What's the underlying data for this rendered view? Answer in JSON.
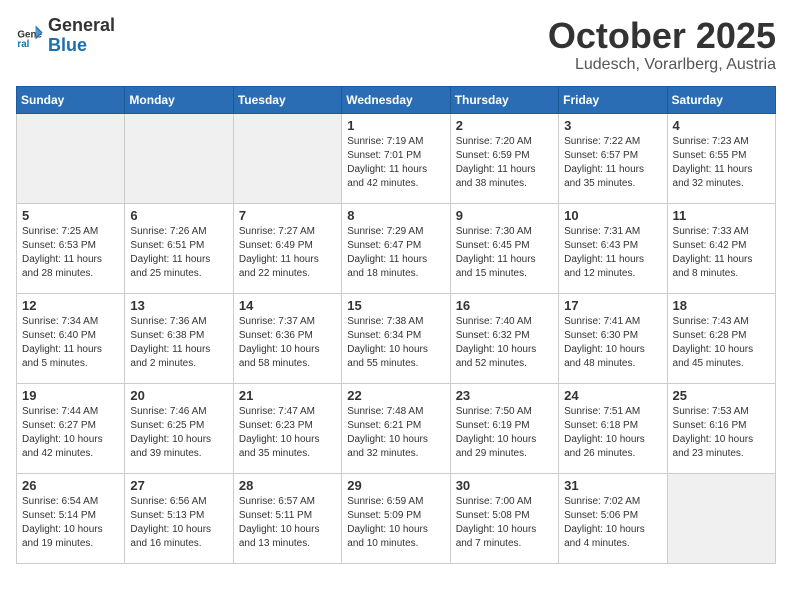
{
  "header": {
    "logo_general": "General",
    "logo_blue": "Blue",
    "month": "October 2025",
    "location": "Ludesch, Vorarlberg, Austria"
  },
  "days_of_week": [
    "Sunday",
    "Monday",
    "Tuesday",
    "Wednesday",
    "Thursday",
    "Friday",
    "Saturday"
  ],
  "weeks": [
    [
      {
        "day": "",
        "info": ""
      },
      {
        "day": "",
        "info": ""
      },
      {
        "day": "",
        "info": ""
      },
      {
        "day": "1",
        "info": "Sunrise: 7:19 AM\nSunset: 7:01 PM\nDaylight: 11 hours and 42 minutes."
      },
      {
        "day": "2",
        "info": "Sunrise: 7:20 AM\nSunset: 6:59 PM\nDaylight: 11 hours and 38 minutes."
      },
      {
        "day": "3",
        "info": "Sunrise: 7:22 AM\nSunset: 6:57 PM\nDaylight: 11 hours and 35 minutes."
      },
      {
        "day": "4",
        "info": "Sunrise: 7:23 AM\nSunset: 6:55 PM\nDaylight: 11 hours and 32 minutes."
      }
    ],
    [
      {
        "day": "5",
        "info": "Sunrise: 7:25 AM\nSunset: 6:53 PM\nDaylight: 11 hours and 28 minutes."
      },
      {
        "day": "6",
        "info": "Sunrise: 7:26 AM\nSunset: 6:51 PM\nDaylight: 11 hours and 25 minutes."
      },
      {
        "day": "7",
        "info": "Sunrise: 7:27 AM\nSunset: 6:49 PM\nDaylight: 11 hours and 22 minutes."
      },
      {
        "day": "8",
        "info": "Sunrise: 7:29 AM\nSunset: 6:47 PM\nDaylight: 11 hours and 18 minutes."
      },
      {
        "day": "9",
        "info": "Sunrise: 7:30 AM\nSunset: 6:45 PM\nDaylight: 11 hours and 15 minutes."
      },
      {
        "day": "10",
        "info": "Sunrise: 7:31 AM\nSunset: 6:43 PM\nDaylight: 11 hours and 12 minutes."
      },
      {
        "day": "11",
        "info": "Sunrise: 7:33 AM\nSunset: 6:42 PM\nDaylight: 11 hours and 8 minutes."
      }
    ],
    [
      {
        "day": "12",
        "info": "Sunrise: 7:34 AM\nSunset: 6:40 PM\nDaylight: 11 hours and 5 minutes."
      },
      {
        "day": "13",
        "info": "Sunrise: 7:36 AM\nSunset: 6:38 PM\nDaylight: 11 hours and 2 minutes."
      },
      {
        "day": "14",
        "info": "Sunrise: 7:37 AM\nSunset: 6:36 PM\nDaylight: 10 hours and 58 minutes."
      },
      {
        "day": "15",
        "info": "Sunrise: 7:38 AM\nSunset: 6:34 PM\nDaylight: 10 hours and 55 minutes."
      },
      {
        "day": "16",
        "info": "Sunrise: 7:40 AM\nSunset: 6:32 PM\nDaylight: 10 hours and 52 minutes."
      },
      {
        "day": "17",
        "info": "Sunrise: 7:41 AM\nSunset: 6:30 PM\nDaylight: 10 hours and 48 minutes."
      },
      {
        "day": "18",
        "info": "Sunrise: 7:43 AM\nSunset: 6:28 PM\nDaylight: 10 hours and 45 minutes."
      }
    ],
    [
      {
        "day": "19",
        "info": "Sunrise: 7:44 AM\nSunset: 6:27 PM\nDaylight: 10 hours and 42 minutes."
      },
      {
        "day": "20",
        "info": "Sunrise: 7:46 AM\nSunset: 6:25 PM\nDaylight: 10 hours and 39 minutes."
      },
      {
        "day": "21",
        "info": "Sunrise: 7:47 AM\nSunset: 6:23 PM\nDaylight: 10 hours and 35 minutes."
      },
      {
        "day": "22",
        "info": "Sunrise: 7:48 AM\nSunset: 6:21 PM\nDaylight: 10 hours and 32 minutes."
      },
      {
        "day": "23",
        "info": "Sunrise: 7:50 AM\nSunset: 6:19 PM\nDaylight: 10 hours and 29 minutes."
      },
      {
        "day": "24",
        "info": "Sunrise: 7:51 AM\nSunset: 6:18 PM\nDaylight: 10 hours and 26 minutes."
      },
      {
        "day": "25",
        "info": "Sunrise: 7:53 AM\nSunset: 6:16 PM\nDaylight: 10 hours and 23 minutes."
      }
    ],
    [
      {
        "day": "26",
        "info": "Sunrise: 6:54 AM\nSunset: 5:14 PM\nDaylight: 10 hours and 19 minutes."
      },
      {
        "day": "27",
        "info": "Sunrise: 6:56 AM\nSunset: 5:13 PM\nDaylight: 10 hours and 16 minutes."
      },
      {
        "day": "28",
        "info": "Sunrise: 6:57 AM\nSunset: 5:11 PM\nDaylight: 10 hours and 13 minutes."
      },
      {
        "day": "29",
        "info": "Sunrise: 6:59 AM\nSunset: 5:09 PM\nDaylight: 10 hours and 10 minutes."
      },
      {
        "day": "30",
        "info": "Sunrise: 7:00 AM\nSunset: 5:08 PM\nDaylight: 10 hours and 7 minutes."
      },
      {
        "day": "31",
        "info": "Sunrise: 7:02 AM\nSunset: 5:06 PM\nDaylight: 10 hours and 4 minutes."
      },
      {
        "day": "",
        "info": ""
      }
    ]
  ]
}
